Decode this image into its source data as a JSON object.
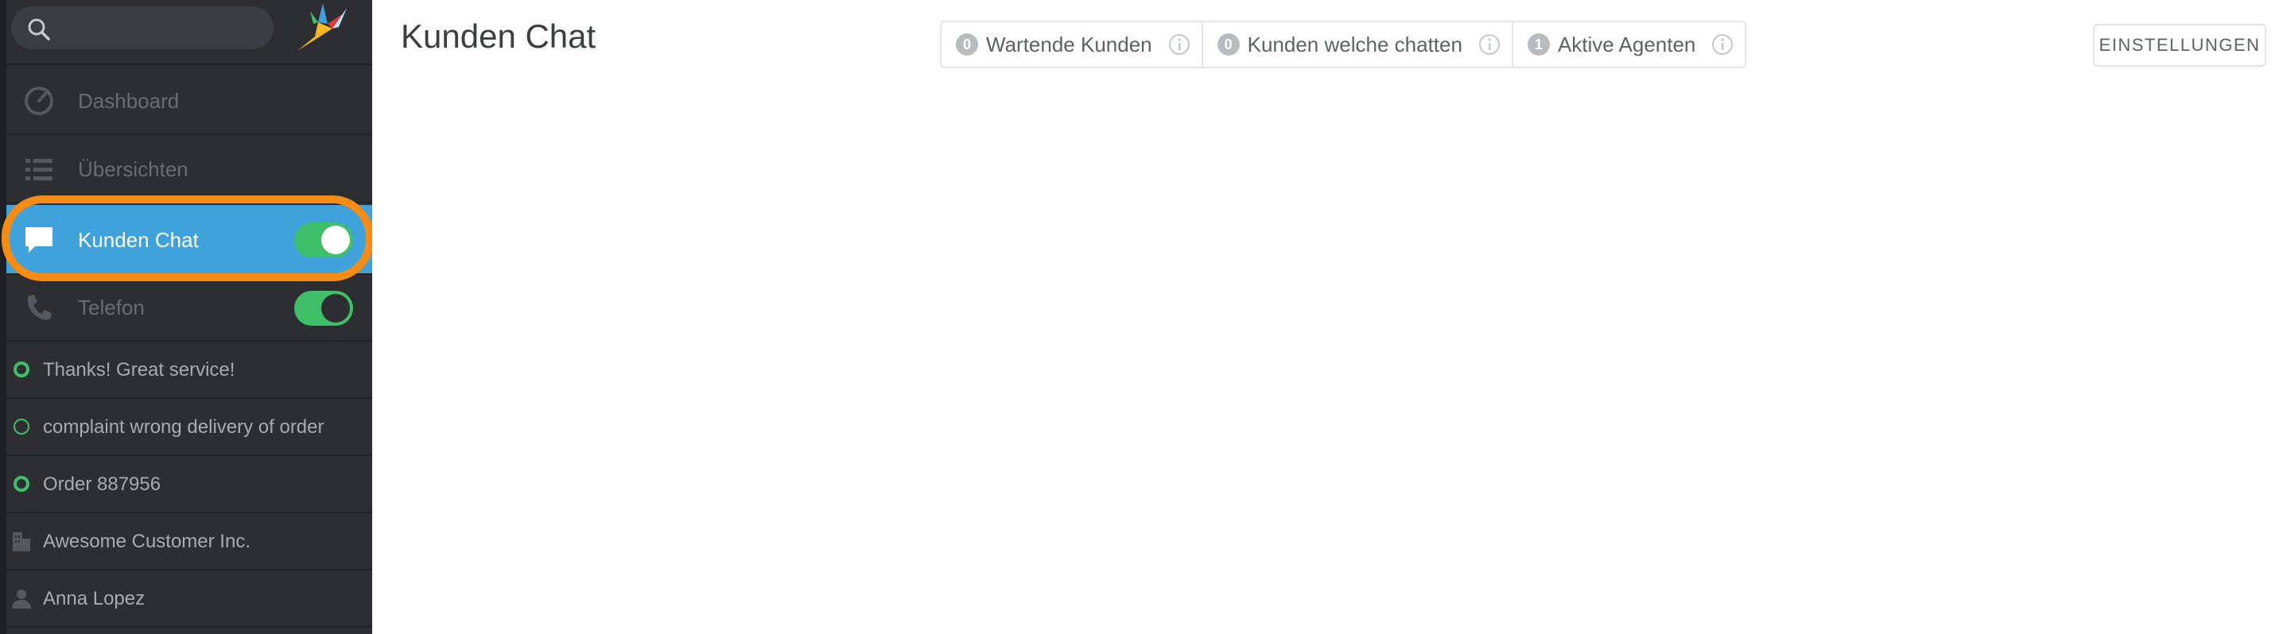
{
  "search": {
    "placeholder": ""
  },
  "sidebar": {
    "nav": [
      {
        "label": "Dashboard",
        "icon": "dashboard-icon"
      },
      {
        "label": "Übersichten",
        "icon": "list-icon"
      },
      {
        "label": "Kunden Chat",
        "icon": "chat-icon",
        "active": true,
        "toggle": "on"
      },
      {
        "label": "Telefon",
        "icon": "phone-icon",
        "toggle": "on"
      }
    ],
    "tabs": [
      {
        "label": "Thanks! Great service!",
        "icon": "ticket-open-icon"
      },
      {
        "label": "complaint wrong delivery of order",
        "icon": "ticket-new-icon"
      },
      {
        "label": "Order 887956",
        "icon": "ticket-open-icon"
      },
      {
        "label": "Awesome Customer Inc.",
        "icon": "organization-icon"
      },
      {
        "label": "Anna Lopez",
        "icon": "user-icon"
      }
    ]
  },
  "main": {
    "title": "Kunden Chat",
    "stats": [
      {
        "count": "0",
        "label": "Wartende Kunden"
      },
      {
        "count": "0",
        "label": "Kunden welche chatten"
      },
      {
        "count": "1",
        "label": "Aktive Agenten"
      }
    ],
    "settings_label": "EINSTELLUNGEN"
  },
  "colors": {
    "sidebar_bg": "#2c2e31",
    "active_blue": "#3fa2db",
    "toggle_green": "#3fbf6a",
    "highlight_orange": "#f58c16"
  }
}
